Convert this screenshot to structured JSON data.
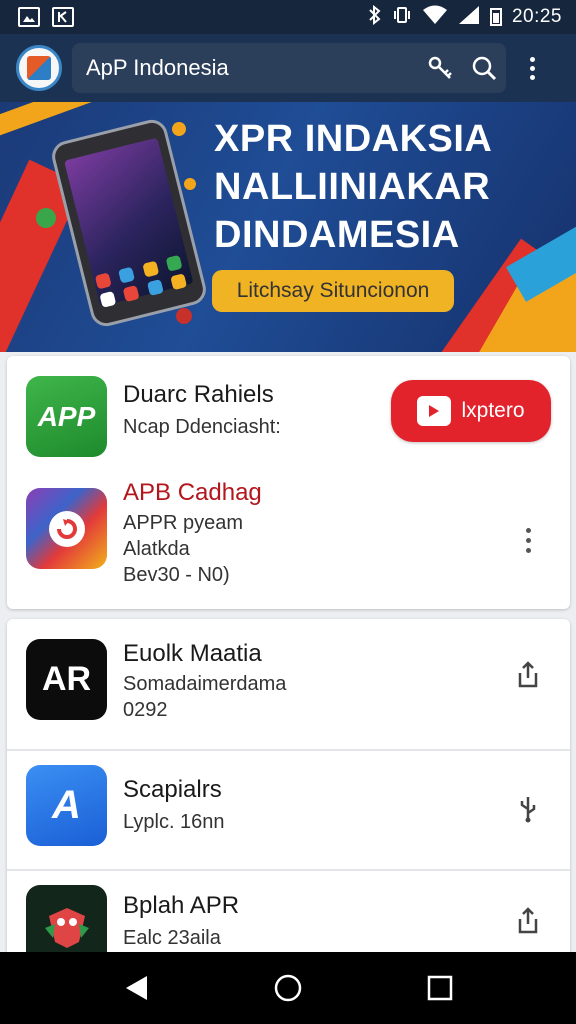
{
  "status_bar": {
    "time": "20:25",
    "left_icons": [
      "image-icon",
      "kindle-icon"
    ],
    "right_icons": [
      "bluetooth-icon",
      "vibrate-icon",
      "wifi-icon",
      "signal-icon",
      "battery-icon"
    ]
  },
  "app_bar": {
    "title": "ApP Indonesia",
    "actions": [
      "key-icon",
      "search-icon",
      "more-vert-icon"
    ]
  },
  "banner": {
    "line1": "XPR INDAKSIA",
    "line2": "NALLIINIAKAR",
    "line3": "DINDAMESIA",
    "pill_label": "Litchsay Situncionon"
  },
  "featured": {
    "items": [
      {
        "name": "Duarc Rahiels",
        "subtitle": "Ncap Ddenciasht:",
        "icon_text": "APP",
        "button_label": "lxptero"
      },
      {
        "name": "APB Cadhag",
        "line1": "APPR pyeam",
        "line2": "Alatkda",
        "line3": "Bev30 - N0)"
      }
    ]
  },
  "list": {
    "items": [
      {
        "name": "Euolk Maatia",
        "line1": "Somadaimerdama",
        "line2": "0292",
        "icon_text": "AR"
      },
      {
        "name": "Scapialrs",
        "line1": "Lyplc. 16nn",
        "icon_text": "A"
      },
      {
        "name": "Bplah APR",
        "line1": "Ealc 23aila"
      }
    ]
  },
  "colors": {
    "status_bar": "#16263d",
    "app_bar": "#1c3252",
    "install_red": "#e3232c",
    "accent_red_text": "#b3161d"
  }
}
